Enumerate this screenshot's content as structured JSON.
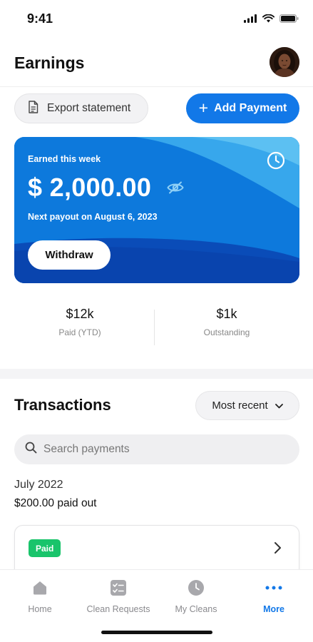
{
  "status_bar": {
    "time": "9:41"
  },
  "header": {
    "title": "Earnings"
  },
  "actions": {
    "export_label": "Export statement",
    "add_payment_label": "Add Payment",
    "add_payment_symbol": "+"
  },
  "earnings_card": {
    "label": "Earned this week",
    "amount": "$ 2,000.00",
    "payout": "Next payout on August 6, 2023",
    "withdraw_label": "Withdraw"
  },
  "stats": [
    {
      "value": "$12k",
      "label": "Paid (YTD)"
    },
    {
      "value": "$1k",
      "label": "Outstanding"
    }
  ],
  "transactions": {
    "title": "Transactions",
    "sort_selected": "Most recent",
    "search_placeholder": "Search payments",
    "month": "July 2022",
    "month_total": "$200.00 paid out",
    "items": [
      {
        "status": "Paid"
      }
    ]
  },
  "tab_bar": {
    "tabs": [
      {
        "label": "Home",
        "icon": "home-icon"
      },
      {
        "label": "Clean Requests",
        "icon": "checklist-icon"
      },
      {
        "label": "My Cleans",
        "icon": "clock-icon"
      },
      {
        "label": "More",
        "icon": "more-dots-icon",
        "active": true
      }
    ]
  },
  "colors": {
    "accent": "#1278e8",
    "paid": "#19c46b",
    "card_dark": "#0a48b4",
    "card_light": "#52b9f0"
  }
}
